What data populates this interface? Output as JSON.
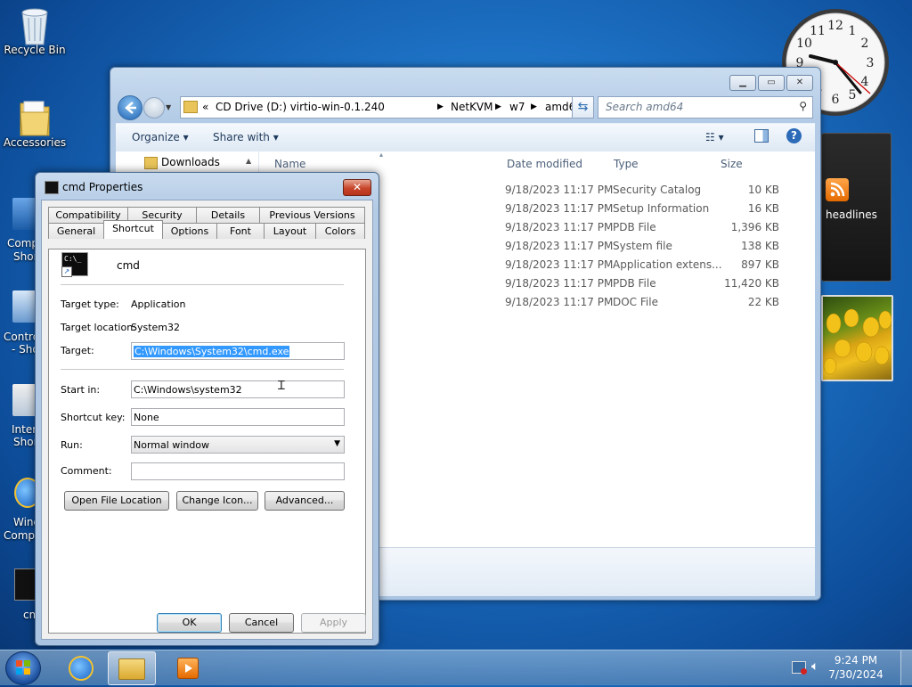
{
  "desktop": {
    "icons": [
      {
        "label": "Recycle Bin"
      },
      {
        "label": "Accessories"
      }
    ],
    "truncated": [
      "Comp",
      "Shor",
      "Contro",
      "- Sho",
      "Interi",
      "Shor",
      "Wind",
      "Compa",
      "cm"
    ]
  },
  "explorer": {
    "address": {
      "prefix": "«",
      "segments": [
        "CD Drive (D:) virtio-win-0.1.240",
        "NetKVM",
        "w7",
        "amd64"
      ]
    },
    "search_placeholder": "Search amd64",
    "toolbar": {
      "organize": "Organize",
      "share": "Share with"
    },
    "nav_item": "Downloads",
    "columns": {
      "name": "Name",
      "date": "Date modified",
      "type": "Type",
      "size": "Size"
    },
    "rows": [
      {
        "date": "9/18/2023 11:17 PM",
        "type": "Security Catalog",
        "size": "10 KB"
      },
      {
        "date": "9/18/2023 11:17 PM",
        "type": "Setup Information",
        "size": "16 KB"
      },
      {
        "date": "9/18/2023 11:17 PM",
        "type": "PDB File",
        "size": "1,396 KB"
      },
      {
        "date": "9/18/2023 11:17 PM",
        "type": "System file",
        "size": "138 KB"
      },
      {
        "date": "9/18/2023 11:17 PM",
        "type": "Application extens...",
        "size": "897 KB"
      },
      {
        "date": "9/18/2023 11:17 PM",
        "type": "PDB File",
        "size": "11,420 KB"
      },
      {
        "date": "9/18/2023 11:17 PM",
        "type": "DOC File",
        "size": "22 KB"
      }
    ]
  },
  "gadgets": {
    "feed_label": "headlines",
    "clock_numbers": [
      "12",
      "1",
      "2",
      "3",
      "4",
      "5",
      "6",
      "7",
      "8",
      "9",
      "10",
      "11"
    ]
  },
  "dialog": {
    "title": "cmd Properties",
    "close": "✕",
    "tabs_top": [
      "Compatibility",
      "Security",
      "Details",
      "Previous Versions"
    ],
    "tabs_bottom": [
      "General",
      "Shortcut",
      "Options",
      "Font",
      "Layout",
      "Colors"
    ],
    "active_tab": "Shortcut",
    "app_name": "cmd",
    "icon_text": "C:\\_",
    "fields": {
      "target_type_label": "Target type:",
      "target_type_value": "Application",
      "target_location_label": "Target location:",
      "target_location_value": "System32",
      "target_label": "Target:",
      "target_value": "C:\\Windows\\System32\\cmd.exe",
      "start_in_label": "Start in:",
      "start_in_value": "C:\\Windows\\system32",
      "shortcut_key_label": "Shortcut key:",
      "shortcut_key_value": "None",
      "run_label": "Run:",
      "run_value": "Normal window",
      "comment_label": "Comment:",
      "comment_value": ""
    },
    "buttons": {
      "open_location": "Open File Location",
      "change_icon": "Change Icon...",
      "advanced": "Advanced...",
      "ok": "OK",
      "cancel": "Cancel",
      "apply": "Apply"
    }
  },
  "taskbar": {
    "time": "9:24 PM",
    "date": "7/30/2024"
  }
}
